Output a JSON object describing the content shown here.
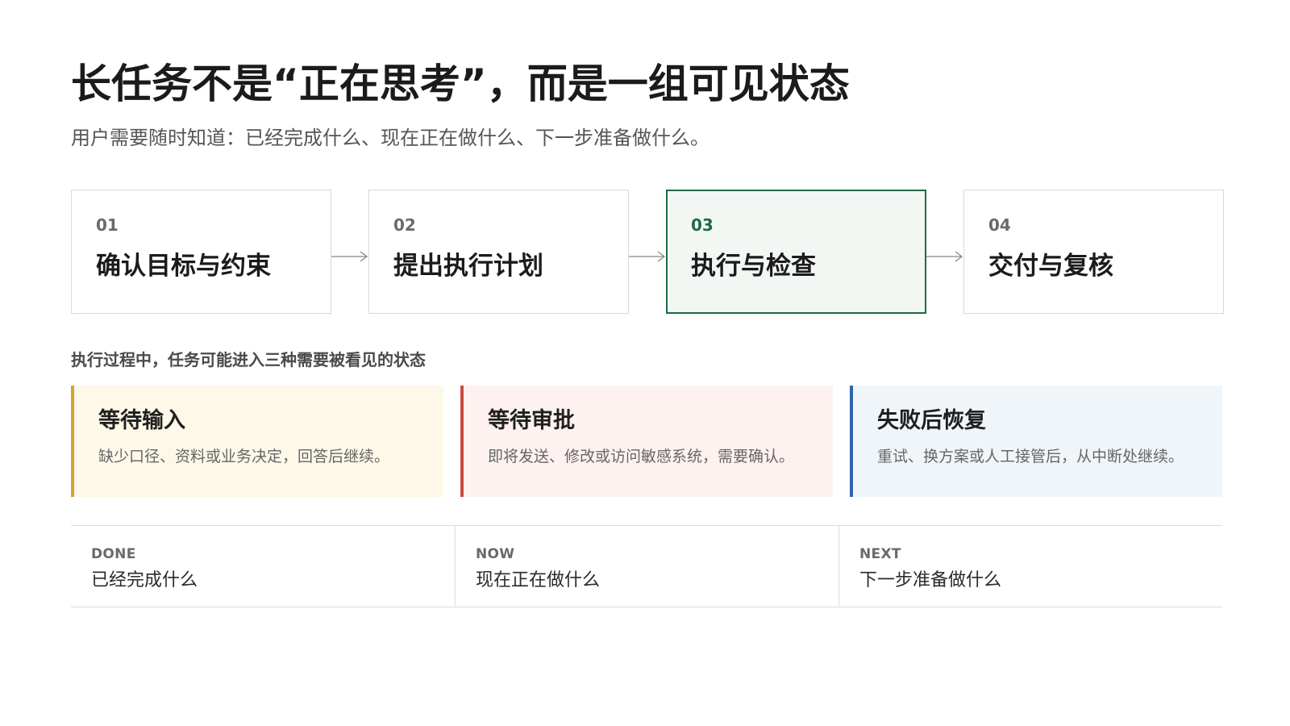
{
  "header": {
    "title": "长任务不是“正在思考”，而是一组可见状态",
    "subtitle": "用户需要随时知道：已经完成什么、现在正在做什么、下一步准备做什么。"
  },
  "steps": [
    {
      "number": "01",
      "label": "确认目标与约束",
      "active": false
    },
    {
      "number": "02",
      "label": "提出执行计划",
      "active": false
    },
    {
      "number": "03",
      "label": "执行与检查",
      "active": true
    },
    {
      "number": "04",
      "label": "交付与复核",
      "active": false
    }
  ],
  "states_section": {
    "label": "执行过程中，任务可能进入三种需要被看见的状态",
    "cards": [
      {
        "title": "等待输入",
        "description": "缺少口径、资料或业务决定，回答后继续。",
        "accent_color": "#d8a22f",
        "background_color": "#fdf8e8"
      },
      {
        "title": "等待审批",
        "description": "即将发送、修改或访问敏感系统，需要确认。",
        "accent_color": "#c84b40",
        "background_color": "#fdf2ef"
      },
      {
        "title": "失败后恢复",
        "description": "重试、换方案或人工接管后，从中断处继续。",
        "accent_color": "#2f66a8",
        "background_color": "#f0f5fa"
      }
    ]
  },
  "status_strip": [
    {
      "key": "DONE",
      "value": "已经完成什么"
    },
    {
      "key": "NOW",
      "value": "现在正在做什么"
    },
    {
      "key": "NEXT",
      "value": "下一步准备做什么"
    }
  ],
  "colors": {
    "active_step": "#1e6b45",
    "active_step_background": "#f2f7f4",
    "border": "#d9d9d9",
    "arrow": "#888888"
  }
}
